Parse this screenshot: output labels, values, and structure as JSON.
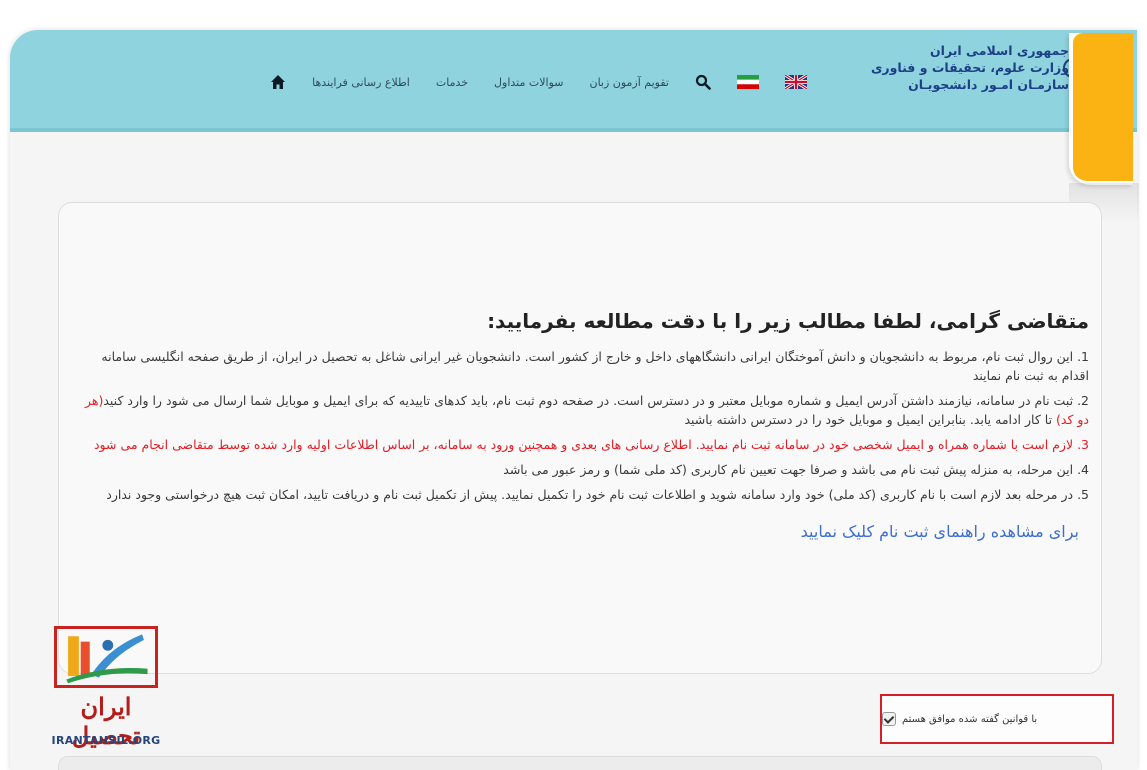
{
  "ministry": {
    "lines": [
      "جمهوری اسلامی ایران",
      "وزارت علوم، تحقیقات و فناوری",
      "سازمـان امـور دانشجویـان"
    ]
  },
  "nav": {
    "items": [
      "اطلاع رسانی فرایندها",
      "خدمات",
      "سوالات متداول",
      "تقویم آزمون زبان"
    ],
    "icons": {
      "home": "home-icon",
      "search": "search-icon",
      "iran_flag": "iran-flag-icon",
      "uk_flag": "uk-flag-icon"
    }
  },
  "main": {
    "heading": "متقاضی گرامی، لطفا مطالب زیر را با دقت مطالعه بفرمایید:",
    "rules": [
      {
        "num": "1.",
        "text": "این روال ثبت نام، مربوط به دانشجویان و دانش آموختگان ایرانی دانشگاههای داخل و خارج از کشور است. دانشجویان غیر ایرانی شاغل به تحصیل در ایران، از طریق صفحه انگلیسی سامانه اقدام به ثبت نام نمایند"
      },
      {
        "num": "2.",
        "text_before": "ثبت نام در سامانه، نیازمند داشتن آدرس ایمیل و شماره موبایل معتبر و در دسترس است. در صفحه دوم ثبت نام، باید کدهای تاییدیه که برای ایمیل و موبایل شما ارسال می شود را وارد کنید",
        "text_red": "(هر دو کد)",
        "text_after": " تا کار ادامه یابد. بنابراین ایمیل و موبایل خود را در دسترس داشته باشید"
      },
      {
        "num": "3.",
        "text": "لازم است با شماره همراه و ایمیل شخصی خود در سامانه ثبت نام نمایید. اطلاع رسانی های بعدی و همچنین ورود به سامانه، بر اساس اطلاعات اولیه وارد شده توسط متقاضی انجام می شود"
      },
      {
        "num": "4.",
        "text": "این مرحله، به منزله پیش ثبت نام می باشد و صرفا جهت تعیین نام کاربری (کد ملی شما) و رمز عبور می باشد"
      },
      {
        "num": "5.",
        "text": "در مرحله بعد لازم است با نام کاربری (کد ملی) خود وارد سامانه شوید و اطلاعات ثبت نام خود را تکمیل نمایید. پیش از تکمیل ثبت نام و دریافت تایید، امکان ثبت هیچ درخواستی وجود ندارد"
      }
    ],
    "guide_link": "برای مشاهده راهنمای ثبت نام کلیک نمایید"
  },
  "agreement": {
    "label": "با قوانین گفته شده موافق هستم",
    "checked": true
  },
  "logo": {
    "wordmark": "ایران تحصیل",
    "domain": "IRANTAHSIL.ORG"
  },
  "colors": {
    "header": "#8fd3de",
    "accent_yellow": "#fbb213",
    "warning_red": "#e31b23",
    "link_blue": "#3c6fd1",
    "ministry_blue": "#1e3f86"
  }
}
